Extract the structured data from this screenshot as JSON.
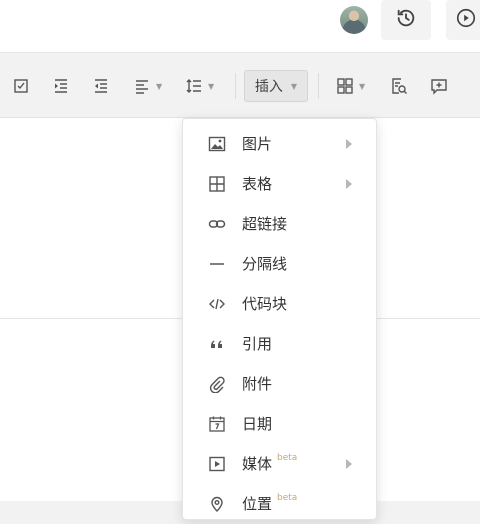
{
  "header": {
    "avatar_icon": "user-avatar",
    "history_icon": "history-icon",
    "play_icon": "play-circle-icon"
  },
  "toolbar": {
    "insert_label": "插入",
    "icons": [
      "checkbox-icon",
      "indent-icon",
      "outdent-icon",
      "align-left-icon",
      "line-height-icon",
      "grid-icon",
      "find-replace-icon",
      "add-comment-icon"
    ]
  },
  "insert_menu": {
    "items": [
      {
        "label": "图片",
        "icon": "image-icon",
        "submenu": true
      },
      {
        "label": "表格",
        "icon": "table-icon",
        "submenu": true
      },
      {
        "label": "超链接",
        "icon": "link-icon",
        "submenu": false
      },
      {
        "label": "分隔线",
        "icon": "divider-icon",
        "submenu": false
      },
      {
        "label": "代码块",
        "icon": "code-icon",
        "submenu": false
      },
      {
        "label": "引用",
        "icon": "quote-icon",
        "submenu": false
      },
      {
        "label": "附件",
        "icon": "paperclip-icon",
        "submenu": false
      },
      {
        "label": "日期",
        "icon": "calendar-icon",
        "submenu": false
      },
      {
        "label": "媒体",
        "icon": "media-icon",
        "submenu": true,
        "badge": "beta"
      },
      {
        "label": "位置",
        "icon": "location-icon",
        "submenu": false,
        "badge": "beta"
      }
    ]
  }
}
